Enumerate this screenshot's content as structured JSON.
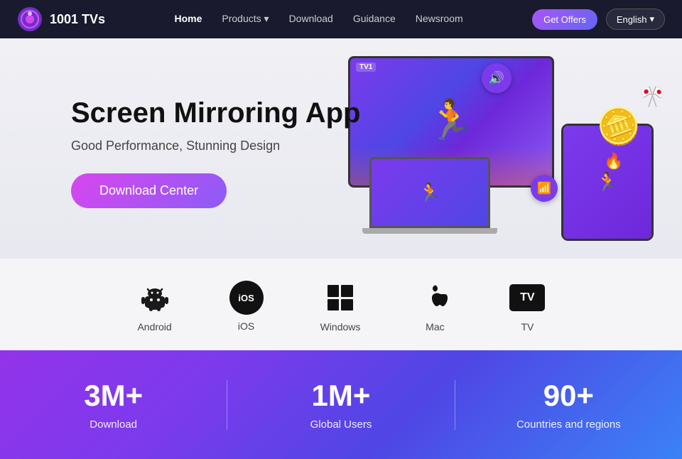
{
  "brand": {
    "name": "1001 TVs"
  },
  "navbar": {
    "links": [
      {
        "label": "Home",
        "active": true
      },
      {
        "label": "Products",
        "hasDropdown": true
      },
      {
        "label": "Download"
      },
      {
        "label": "Guidance"
      },
      {
        "label": "Newsroom"
      }
    ],
    "offers_button": "Get Offers",
    "lang_button": "English",
    "lang_arrow": "▾"
  },
  "hero": {
    "title": "Screen Mirroring App",
    "subtitle": "Good Performance, Stunning Design",
    "cta_button": "Download Center"
  },
  "platforms": {
    "items": [
      {
        "label": "Android"
      },
      {
        "label": "iOS"
      },
      {
        "label": "Windows"
      },
      {
        "label": "Mac"
      },
      {
        "label": "TV"
      }
    ]
  },
  "stats": {
    "items": [
      {
        "number": "3M+",
        "label": "Download"
      },
      {
        "number": "1M+",
        "label": "Global Users"
      },
      {
        "number": "90+",
        "label": "Countries and regions"
      }
    ]
  }
}
